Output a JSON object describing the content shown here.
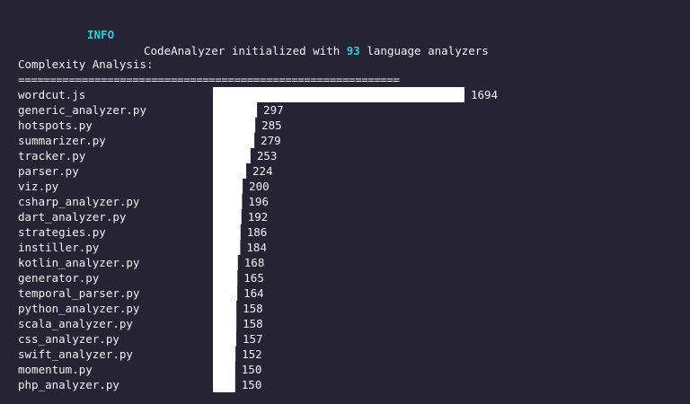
{
  "log": {
    "level": "INFO",
    "message_before": "CodeAnalyzer initialized with ",
    "count": "93",
    "message_after": " language analyzers"
  },
  "section_title": "Complexity Analysis:",
  "separator": "============================================================",
  "colors": {
    "background": "#262335",
    "text": "#f2f2f2",
    "accent": "#3bc8d6",
    "bar": "#ffffff"
  },
  "chart_data": {
    "type": "bar",
    "orientation": "horizontal",
    "title": "Complexity Analysis:",
    "categories": [
      "wordcut.js",
      "generic_analyzer.py",
      "hotspots.py",
      "summarizer.py",
      "tracker.py",
      "parser.py",
      "viz.py",
      "csharp_analyzer.py",
      "dart_analyzer.py",
      "strategies.py",
      "instiller.py",
      "kotlin_analyzer.py",
      "generator.py",
      "temporal_parser.py",
      "python_analyzer.py",
      "scala_analyzer.py",
      "css_analyzer.py",
      "swift_analyzer.py",
      "momentum.py",
      "php_analyzer.py"
    ],
    "values": [
      1694,
      297,
      285,
      279,
      253,
      224,
      200,
      196,
      192,
      186,
      184,
      168,
      165,
      164,
      158,
      158,
      157,
      152,
      150,
      150
    ],
    "xlim": [
      0,
      1694
    ],
    "grid": false
  }
}
